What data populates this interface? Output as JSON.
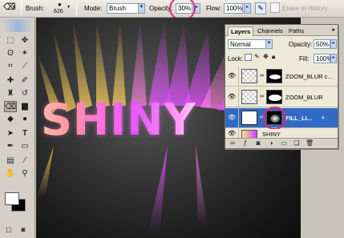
{
  "options_bar": {
    "brush_label": "Brush:",
    "brush_size": "626",
    "mode_label": "Mode:",
    "mode_value": "Brush",
    "opacity_label": "Opacity:",
    "opacity_value": "30%",
    "flow_label": "Flow:",
    "flow_value": "100%",
    "erase_history_label": "Erase to History"
  },
  "canvas": {
    "text": "SHINY"
  },
  "layers_palette": {
    "tabs": [
      "Layers",
      "Channels",
      "Paths"
    ],
    "blend_mode": "Normal",
    "opacity_label": "Opacity:",
    "opacity_value": "50%",
    "lock_label": "Lock:",
    "fill_label": "Fill:",
    "fill_value": "100%",
    "layers": [
      {
        "name": "ZOOM_BLUR c...",
        "active": false
      },
      {
        "name": "ZOOM_BLUR",
        "active": false
      },
      {
        "name": "FILL_LI...",
        "active": true
      },
      {
        "name": "SHINY",
        "active": false
      }
    ]
  },
  "colors": {
    "highlight_circle": "#e0257a",
    "selected_layer": "#316ac5"
  }
}
